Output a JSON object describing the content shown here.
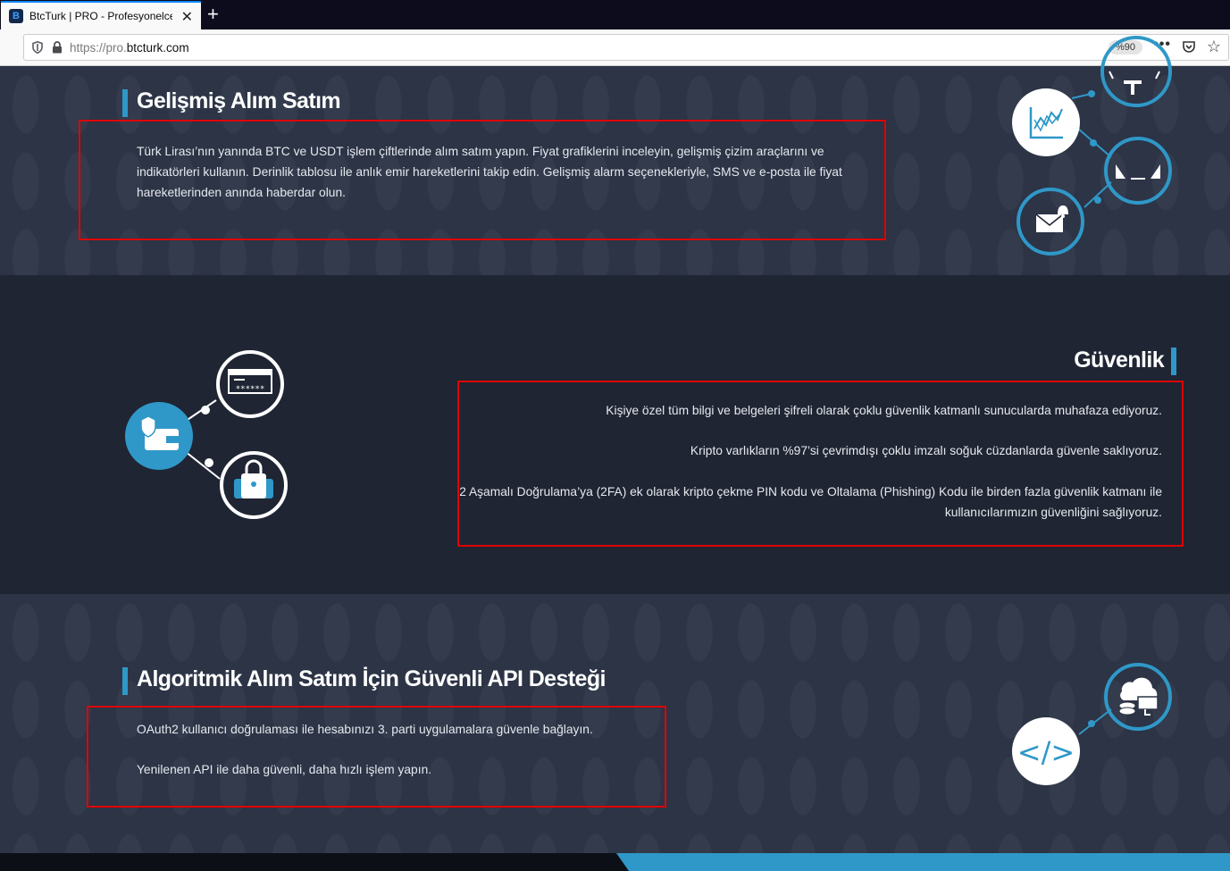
{
  "browser": {
    "tab_title": "BtcTurk | PRO - Profesyonelce Kripto",
    "url_scheme": "https://pro.",
    "url_host": "btcturk.com",
    "zoom": "%90"
  },
  "sections": {
    "trading": {
      "title": "Gelişmiş Alım Satım",
      "text": "Türk Lirası’nın yanında BTC ve USDT işlem çiftlerinde alım satım yapın. Fiyat grafiklerini inceleyin, gelişmiş çizim araçlarını ve indikatörleri kullanın. Derinlik tablosu ile anlık emir hareketlerini takip edin. Gelişmiş alarm seçenekleriyle, SMS ve e-posta ile fiyat hareketlerinden anında haberdar olun."
    },
    "security": {
      "title": "Güvenlik",
      "p1": "Kişiye özel tüm bilgi ve belgeleri şifreli olarak çoklu güvenlik katmanlı sunucularda muhafaza ediyoruz.",
      "p2": "Kripto varlıkların %97’si çevrimdışı çoklu imzalı soğuk cüzdanlarda güvenle saklıyoruz.",
      "p3": "2 Aşamalı Doğrulama’ya (2FA) ek olarak kripto çekme PIN kodu ve Oltalama (Phishing) Kodu ile birden fazla güvenlik katmanı ile kullanıcılarımızın güvenliğini sağlıyoruz."
    },
    "api": {
      "title": "Algoritmik Alım Satım İçin Güvenli API Desteği",
      "p1": "OAuth2 kullanıcı doğrulaması ile hesabınızı 3. parti uygulamalara güvenle bağlayın.",
      "p2": "Yenilenen API ile daha güvenli, daha hızlı işlem yapın."
    }
  },
  "icons": {
    "security_password_field": "******",
    "api_code": "</>"
  },
  "colors": {
    "accent": "#2f98c8",
    "annotation": "#e00000"
  }
}
